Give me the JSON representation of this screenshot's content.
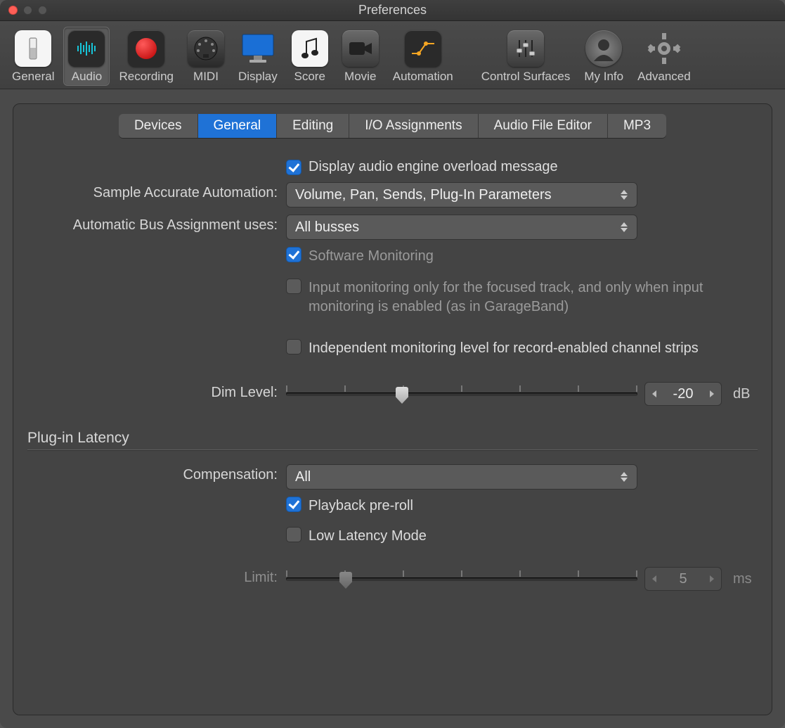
{
  "window": {
    "title": "Preferences"
  },
  "toolbar": {
    "items": [
      {
        "id": "general",
        "label": "General"
      },
      {
        "id": "audio",
        "label": "Audio"
      },
      {
        "id": "recording",
        "label": "Recording"
      },
      {
        "id": "midi",
        "label": "MIDI"
      },
      {
        "id": "display",
        "label": "Display"
      },
      {
        "id": "score",
        "label": "Score"
      },
      {
        "id": "movie",
        "label": "Movie"
      },
      {
        "id": "automation",
        "label": "Automation"
      },
      {
        "id": "control",
        "label": "Control Surfaces"
      },
      {
        "id": "myinfo",
        "label": "My Info"
      },
      {
        "id": "advanced",
        "label": "Advanced"
      }
    ],
    "selected": "audio"
  },
  "tabs": {
    "items": [
      "Devices",
      "General",
      "Editing",
      "I/O Assignments",
      "Audio File Editor",
      "MP3"
    ],
    "selected": "General"
  },
  "form": {
    "overload_label": "Display audio engine overload message",
    "overload_checked": true,
    "saa_label": "Sample Accurate Automation:",
    "saa_value": "Volume, Pan, Sends, Plug-In Parameters",
    "bus_label": "Automatic Bus Assignment uses:",
    "bus_value": "All busses",
    "softmon_label": "Software Monitoring",
    "softmon_checked": true,
    "inputmon_label": "Input monitoring only for the focused track, and only when input monitoring is enabled (as in GarageBand)",
    "inputmon_checked": false,
    "indepmon_label": "Independent monitoring level for record-enabled channel strips",
    "indepmon_checked": false,
    "dim_label": "Dim Level:",
    "dim_value": "-20",
    "dim_unit": "dB",
    "dim_slider_pct": 33
  },
  "latency": {
    "section_title": "Plug-in Latency",
    "comp_label": "Compensation:",
    "comp_value": "All",
    "preroll_label": "Playback pre-roll",
    "preroll_checked": true,
    "lowlat_label": "Low Latency Mode",
    "lowlat_checked": false,
    "limit_label": "Limit:",
    "limit_value": "5",
    "limit_unit": "ms",
    "limit_slider_pct": 17
  }
}
